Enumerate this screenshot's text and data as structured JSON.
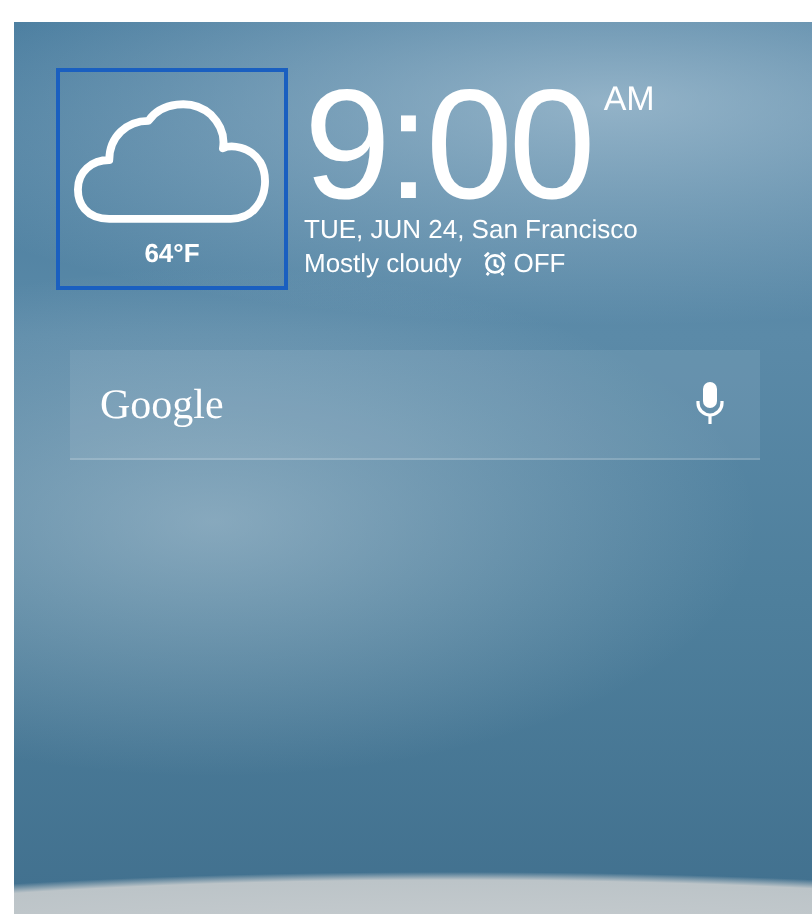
{
  "weather": {
    "temperature": "64°F",
    "selected": true
  },
  "clock": {
    "time": "9:00",
    "ampm": "AM",
    "date": "TUE, JUN 24, San Francisco",
    "condition": "Mostly cloudy",
    "alarm": "OFF"
  },
  "search": {
    "brand": "Google"
  }
}
